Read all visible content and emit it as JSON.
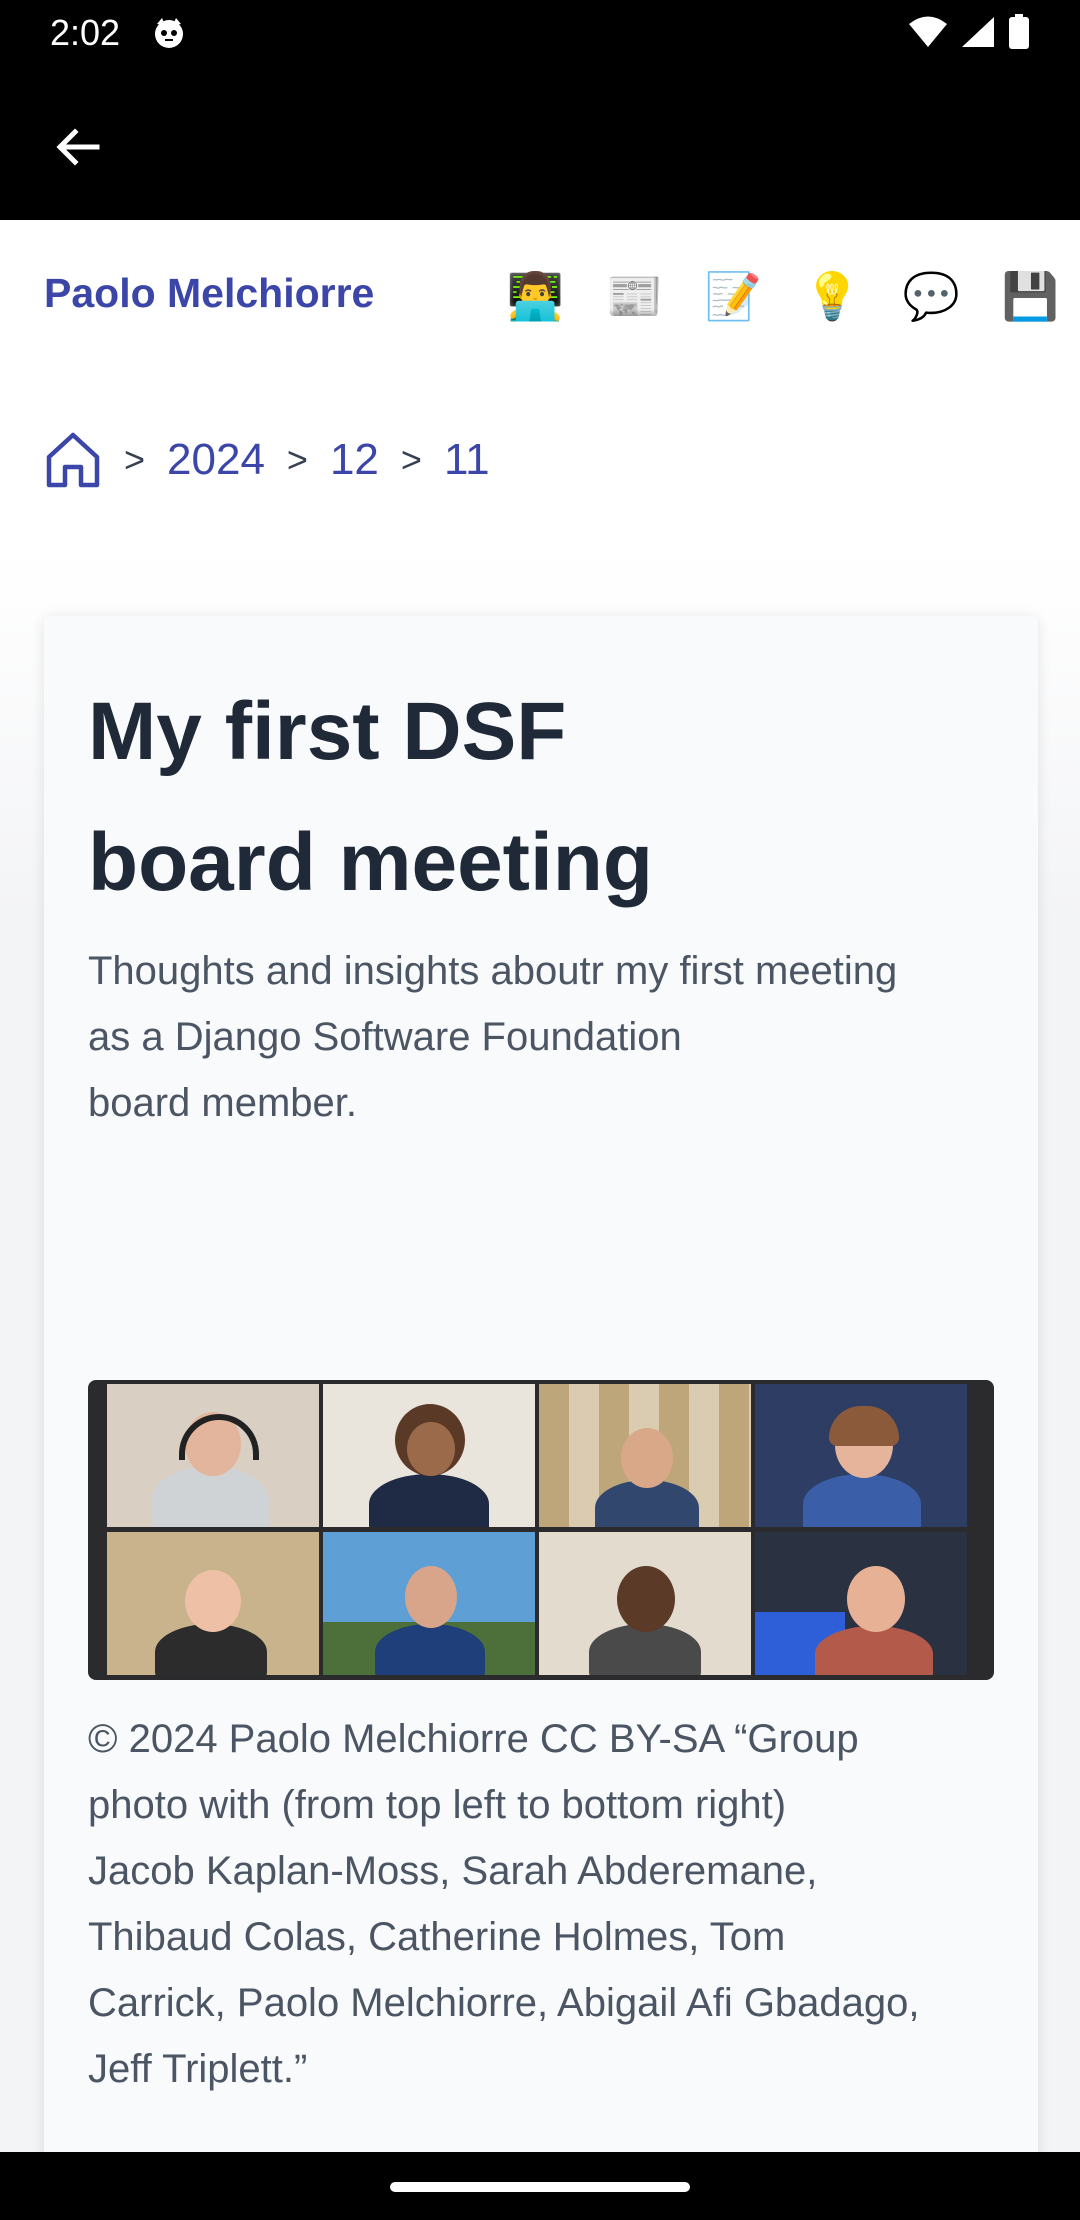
{
  "status_bar": {
    "time": "2:02",
    "icons": [
      "cat-notification-icon",
      "wifi-icon",
      "signal-icon",
      "battery-icon"
    ]
  },
  "app_bar": {
    "back_icon": "arrow-left-icon"
  },
  "site": {
    "title": "Paolo Melchiorre",
    "nav_icons": [
      {
        "name": "developer-icon",
        "glyph": "👨‍💻"
      },
      {
        "name": "newspaper-icon",
        "glyph": "📰"
      },
      {
        "name": "memo-icon",
        "glyph": "📝"
      },
      {
        "name": "light-bulb-icon",
        "glyph": "💡"
      },
      {
        "name": "speech-bubble-icon",
        "glyph": "💬"
      },
      {
        "name": "floppy-disk-icon",
        "glyph": "💾"
      }
    ]
  },
  "breadcrumb": {
    "home_icon": "home-icon",
    "separator": ">",
    "items": [
      "2024",
      "12",
      "11"
    ]
  },
  "post": {
    "title_line1": "My first DSF",
    "title_line2": "board meeting",
    "subtitle_line1": "Thoughts and insights aboutr my first meeting",
    "subtitle_line2": "as a Django Software Foundation",
    "subtitle_line3": "board member.",
    "caption_line1": "© 2024 Paolo Melchiorre CC BY-SA “Group",
    "caption_line2": "photo with (from top left to bottom right)",
    "caption_line3": "Jacob Kaplan-Moss, Sarah Abderemane,",
    "caption_line4": "Thibaud Colas, Catherine Holmes, Tom",
    "caption_line5": "Carrick, Paolo Melchiorre, Abigail Afi Gbadago,",
    "caption_line6": "Jeff Triplett.”"
  },
  "colors": {
    "link": "#3b46a8",
    "heading": "#1f2937",
    "body_text": "#4b5563",
    "card_bg": "#f9fafb",
    "system_bars": "#000000"
  }
}
